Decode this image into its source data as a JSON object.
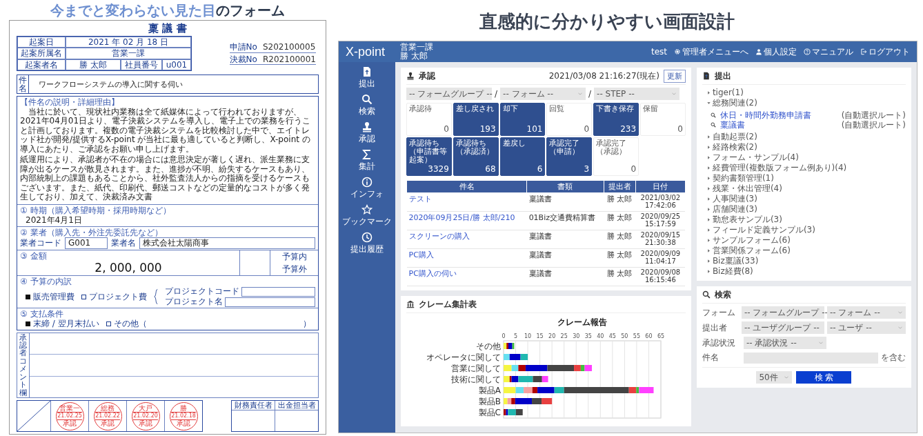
{
  "headline_left": {
    "highlight": "今までと変わらない見た目",
    "rest": "の",
    "line2": "フォーム"
  },
  "headline_right": "直感的に分かりやすい画面設計",
  "paper_form": {
    "title": "稟 議 書",
    "date": {
      "label": "起案日",
      "value": "2021 年 02 月 18 日"
    },
    "department": {
      "label": "起案所属名",
      "value": "営業一課"
    },
    "drafter": {
      "label": "起案者名",
      "value": "勝 太郎",
      "id_label": "社員番号",
      "id_value": "u001"
    },
    "numbers": [
      {
        "label": "申請No",
        "value": "S202100005"
      },
      {
        "label": "決裁No",
        "value": "R202100001"
      }
    ],
    "subject": {
      "label": "件名",
      "value": "ワークフローシステムの導入に関する伺い"
    },
    "reason": {
      "label": "【件名の説明・詳細理由】",
      "paragraphs": [
        "当社に於いて、現状社内業務は全て紙媒体によって行われておりますが、2021年04月01日より、電子決裁システムを導入し、電子上での業務を行うこと計画しております。複数の電子決裁システムを比較検討した中で、エイトレッド社が開発/提供するX-point が当社に最も適していると判断し、X-point の導入にあたり、ご承認をお願い申し上げます。",
        "紙運用により、承認者が不在の場合には意思決定が著しく遅れ、派生業務に支障が出るケースが散見されます。また、進捗が不明、紛失するケースもあり、内部統制上の課題もあることから、社外監査法人からの指摘を受けるケースもございます。また、紙代、印刷代、郵送コストなどの定量的なコストが多く発生しており、加えて、決裁済み文書"
      ]
    },
    "timing": {
      "label": "① 時期（購入希望時期・採用時期など）",
      "value": "2021年4月1日"
    },
    "vendor": {
      "label": "② 業者（購入先・外注先委託先など）",
      "code_label": "業者コード",
      "code": "G001",
      "name_label": "業者名",
      "name": "株式会社太陽商事"
    },
    "amount": {
      "label": "③ 金額",
      "value": "2, 000, 000",
      "budget": [
        "予算内",
        "予算外"
      ]
    },
    "breakdown": {
      "label": "④ 予算の内訳",
      "options": [
        {
          "label": "販売管理費",
          "selected": true
        },
        {
          "label": "プロジェクト費",
          "selected": false
        }
      ],
      "project_fields": [
        "プロジェクトコード",
        "プロジェクト名"
      ]
    },
    "payment": {
      "label": "⑤ 支払条件",
      "options": [
        {
          "label": "末締 / 翌月末払い",
          "selected": true
        },
        {
          "label": "その他（",
          "selected": false
        }
      ],
      "close": "）"
    },
    "comment_label": "承認者コメント欄",
    "stamps": [
      {
        "name": "営業一",
        "date": "21.02.25",
        "status": "承認"
      },
      {
        "name": "総務",
        "date": "21.02.22",
        "status": "承認"
      },
      {
        "name": "大戸",
        "date": "21.02.20",
        "status": "承認"
      },
      {
        "name": "勝",
        "date": "21.02.18",
        "status": "承認"
      }
    ],
    "signoff": [
      "財務責任者",
      "出金担当者"
    ]
  },
  "app": {
    "logo": "X-point",
    "user": {
      "department": "営業一課",
      "name": "勝 太郎"
    },
    "header_links": [
      {
        "label": "test"
      },
      {
        "label": "管理者メニューへ"
      },
      {
        "label": "個人設定"
      },
      {
        "label": "マニュアル"
      },
      {
        "label": "ログアウト"
      }
    ],
    "sidebar": [
      {
        "label": "提出"
      },
      {
        "label": "検索"
      },
      {
        "label": "承認"
      },
      {
        "label": "集計"
      },
      {
        "label": "インフォ"
      },
      {
        "label": "ブックマーク"
      },
      {
        "label": "提出履歴"
      }
    ],
    "approval": {
      "title": "承認",
      "timestamp": "2021/03/08 21:16:27(現在)",
      "refresh": "更新",
      "filters": [
        {
          "value": "-- フォームグループ --"
        },
        {
          "separator": "/",
          "value": "-- フォーム --"
        },
        {
          "separator": "/",
          "value": "-- STEP --"
        }
      ],
      "tiles": [
        {
          "label": "承認待",
          "count": "0",
          "highlighted": false
        },
        {
          "label": "差し戻され",
          "count": "193",
          "highlighted": true
        },
        {
          "label": "却下",
          "count": "101",
          "highlighted": true
        },
        {
          "label": "回覧",
          "count": "0",
          "highlighted": false
        },
        {
          "label": "下書き保存",
          "count": "233",
          "highlighted": true
        },
        {
          "label": "保留",
          "count": "0",
          "highlighted": false
        },
        {
          "label": "承認待ち（申請書等起案）",
          "count": "3329",
          "highlighted": true
        },
        {
          "label": "承認待ち（承認済）",
          "count": "68",
          "highlighted": true
        },
        {
          "label": "差戻し",
          "count": "6",
          "highlighted": true
        },
        {
          "label": "承認完了（申請）",
          "count": "3",
          "highlighted": true
        },
        {
          "label": "承認完了（承認）",
          "count": "0",
          "highlighted": false
        }
      ],
      "columns": [
        "件名",
        "書類",
        "提出者",
        "日付"
      ],
      "rows": [
        {
          "title": "テスト",
          "document": "稟議書",
          "submitter": "勝 太郎",
          "date": "2021/03/02 17:42:06"
        },
        {
          "title": "2020年09月25日/勝 太郎/210",
          "document": "01Biz交通費精算書",
          "submitter": "勝 太郎",
          "date": "2020/09/25 15:17:59"
        },
        {
          "title": "スクリーンの購入",
          "document": "稟議書",
          "submitter": "勝 太郎",
          "date": "2020/09/15 21:30:38"
        },
        {
          "title": "PC購入",
          "document": "稟議書",
          "submitter": "勝 太郎",
          "date": "2020/09/09 11:04:17"
        },
        {
          "title": "PC購入の伺い",
          "document": "稟議書",
          "submitter": "勝 太郎",
          "date": "2020/09/08 16:15:46"
        }
      ]
    },
    "chart_panel": {
      "title": "クレーム集計表",
      "chart_data": {
        "type": "bar",
        "orientation": "horizontal",
        "stacked": true,
        "title": "クレーム報告",
        "categories": [
          "その他",
          "オペレータに関して",
          "営業に関して",
          "技術に関して",
          "製品A",
          "製品B",
          "製品C"
        ],
        "grid": true,
        "xlim": [
          0,
          65
        ],
        "xticks": [
          0,
          5,
          10,
          15,
          20,
          25,
          30,
          35,
          40,
          45,
          50,
          55,
          60,
          65
        ],
        "series": [
          {
            "color": "#f5f542",
            "values": [
              1.2,
              0,
              3.3,
              2.5,
              5,
              1.6,
              0
            ]
          },
          {
            "color": "#66e0f0",
            "values": [
              0,
              2.5,
              2.8,
              0,
              3.3,
              0,
              0
            ]
          },
          {
            "color": "#f5a0a0",
            "values": [
              0,
              0,
              0,
              0,
              3.6,
              1.6,
              0
            ]
          },
          {
            "color": "#b00000",
            "values": [
              0.8,
              0,
              3,
              0.8,
              2.1,
              1.6,
              1
            ]
          },
          {
            "color": "#0000c8",
            "values": [
              1.6,
              4.5,
              9,
              2.8,
              7,
              6.9,
              0.8
            ]
          },
          {
            "color": "#20b8b0",
            "values": [
              0,
              3,
              0,
              6,
              4,
              0,
              3.3
            ]
          },
          {
            "color": "#444444",
            "values": [
              0,
              0,
              11,
              3.8,
              26.8,
              4,
              2.8
            ]
          },
          {
            "color": "#e84040",
            "values": [
              0,
              0,
              2.8,
              0,
              3,
              4.3,
              0
            ]
          },
          {
            "color": "#40c040",
            "values": [
              0.8,
              0,
              1.6,
              0,
              1.2,
              0,
              0
            ]
          },
          {
            "color": "#ff40ff",
            "values": [
              0,
              0,
              3,
              2.5,
              6,
              0,
              0
            ]
          }
        ]
      }
    },
    "submit": {
      "title": "提出",
      "tree": [
        {
          "label": "tiger(1)",
          "expanded": false
        },
        {
          "label": "総務関連(2)",
          "expanded": true,
          "children": [
            {
              "label": "休日・時間外勤務申請書",
              "route": "(自動選択ルート)"
            },
            {
              "label": "稟議書",
              "route": "(自動選択ルート)"
            }
          ]
        },
        {
          "label": "自動起票(2)",
          "expanded": false
        },
        {
          "label": "経路検索(2)",
          "expanded": false
        },
        {
          "label": "フォーム・サンプル(4)",
          "expanded": false
        },
        {
          "label": "経費管理(複数版フォーム例あり)(4)",
          "expanded": false
        },
        {
          "label": "契約書類管理(1)",
          "expanded": false
        },
        {
          "label": "残業・休出管理(4)",
          "expanded": false
        },
        {
          "label": "人事関連(3)",
          "expanded": false
        },
        {
          "label": "店舗関連(3)",
          "expanded": false
        },
        {
          "label": "勤怠表サンプル(3)",
          "expanded": false
        },
        {
          "label": "フィールド定義サンプル(3)",
          "expanded": false
        },
        {
          "label": "サンプルフォーム(6)",
          "expanded": false
        },
        {
          "label": "営業関係フォーム(6)",
          "expanded": false
        },
        {
          "label": "Biz稟議(33)",
          "expanded": false
        },
        {
          "label": "Biz経費(8)",
          "expanded": false
        }
      ]
    },
    "search": {
      "title": "検索",
      "rows": [
        {
          "kind": "select",
          "label": "フォーム",
          "selects": [
            "-- フォームグループ --",
            "-- フォーム --"
          ]
        },
        {
          "kind": "select",
          "label": "提出者",
          "selects": [
            "-- ユーザグループ --",
            "-- ユーザ --"
          ]
        },
        {
          "kind": "select",
          "label": "承認状況",
          "selects": [
            "-- 承認状況 --"
          ]
        },
        {
          "kind": "text",
          "label": "件名",
          "suffix": "を含む"
        }
      ],
      "page_size": "50件",
      "submit": "検 索"
    }
  }
}
